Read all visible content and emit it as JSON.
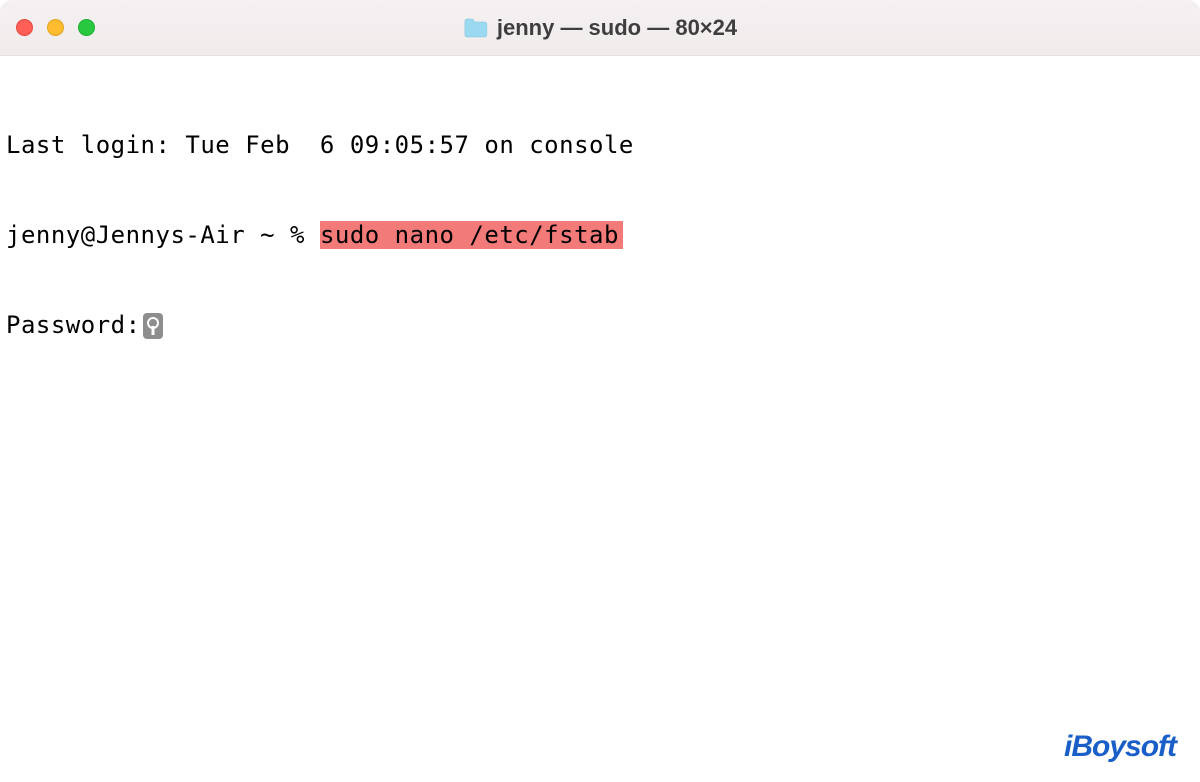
{
  "window": {
    "title": "jenny — sudo — 80×24"
  },
  "terminal": {
    "last_login": "Last login: Tue Feb  6 09:05:57 on console",
    "prompt": "jenny@Jennys-Air ~ % ",
    "command": "sudo nano /etc/fstab",
    "password_prompt": "Password:"
  },
  "watermark": {
    "text": "iBoysoft"
  }
}
